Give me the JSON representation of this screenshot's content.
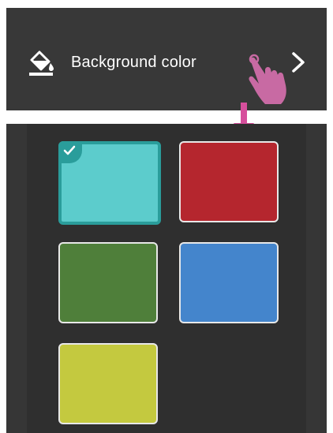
{
  "setting": {
    "label": "Background color",
    "icon": "paint-bucket-icon",
    "chevron": "chevron-right-icon"
  },
  "annotations": {
    "pointer": "touch-hand-icon",
    "pointer_color": "#c86aa3",
    "arrow": "arrow-down-icon",
    "arrow_color": "#d64f9c"
  },
  "colors": [
    {
      "name": "teal",
      "hex": "#5ccccc",
      "selected": true
    },
    {
      "name": "red",
      "hex": "#b5262e",
      "selected": false
    },
    {
      "name": "green",
      "hex": "#4f7f3a",
      "selected": false
    },
    {
      "name": "blue",
      "hex": "#4485cc",
      "selected": false
    },
    {
      "name": "yellow",
      "hex": "#c4c93f",
      "selected": false
    }
  ],
  "selected_color": "teal"
}
